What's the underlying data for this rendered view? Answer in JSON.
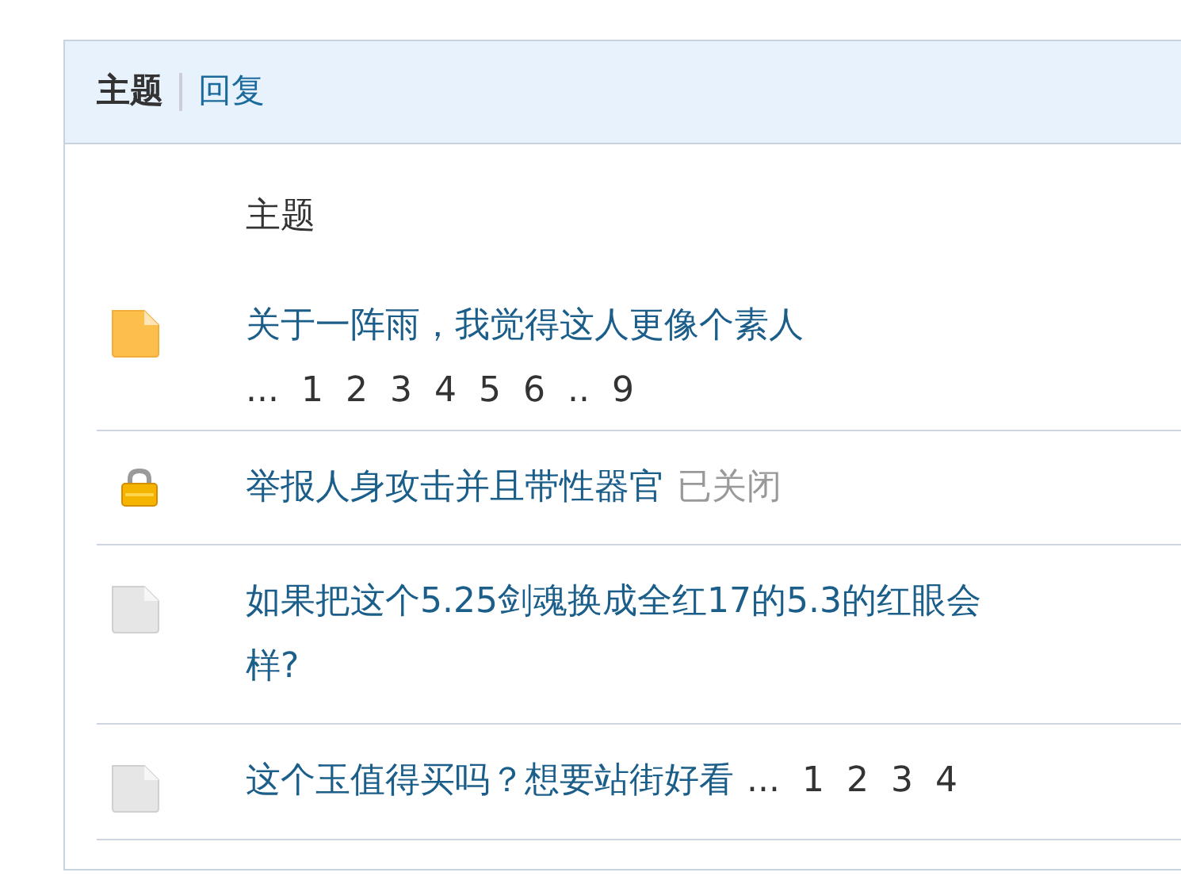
{
  "tabs": [
    {
      "label": "主题",
      "selected": true
    },
    {
      "label": "回复",
      "selected": false
    }
  ],
  "table": {
    "columns": [
      "主题"
    ],
    "rows": [
      {
        "kind": "hot",
        "title": "关于一阵雨，我觉得这人更像个素人",
        "pages": [
          "...",
          "1",
          "2",
          "3",
          "4",
          "5",
          "6",
          "..",
          "9"
        ]
      },
      {
        "kind": "locked",
        "title": "举报人身攻击并且带性器官",
        "status": "已关闭"
      },
      {
        "kind": "normal",
        "title": "如果把这个5.25剑魂换成全红17的5.3的红眼会样?"
      },
      {
        "kind": "normal",
        "title": "这个玉值得买吗？想要站街好看",
        "pages": [
          "...",
          "1",
          "2",
          "3",
          "4"
        ]
      }
    ]
  }
}
